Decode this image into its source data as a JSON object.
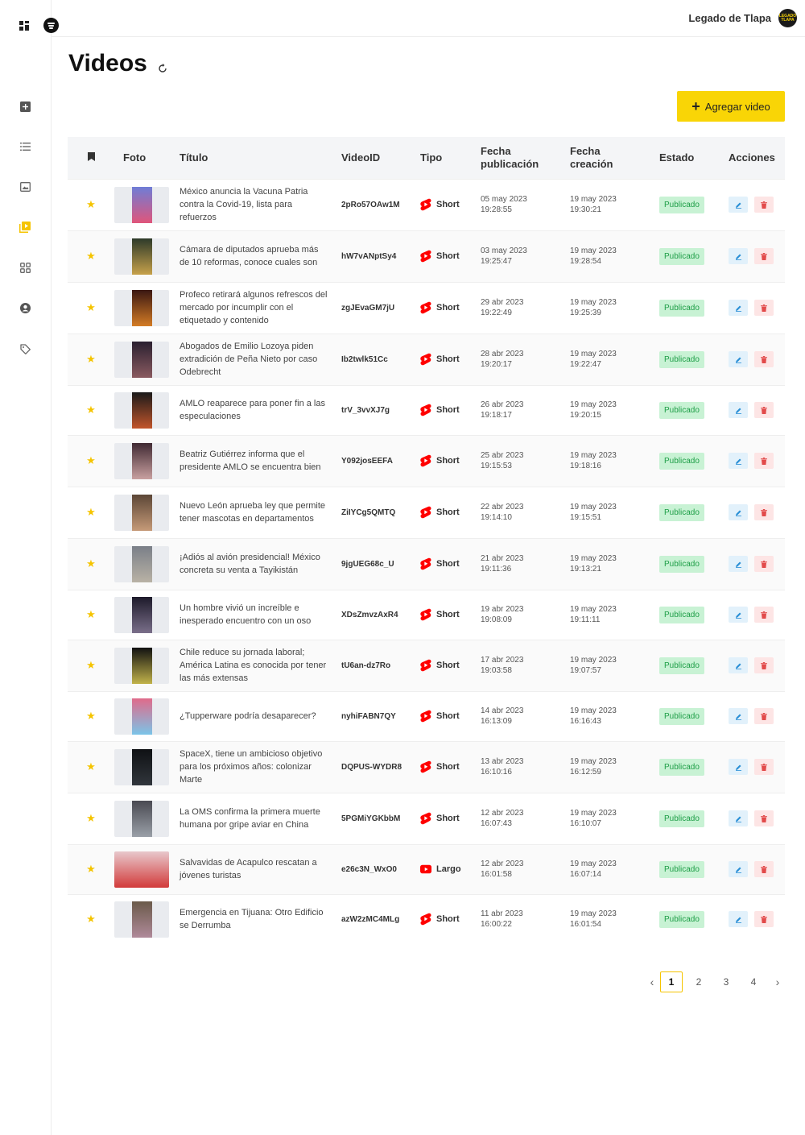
{
  "header": {
    "brand_name": "Legado de Tlapa",
    "brand_avatar_text": "LEGADO TLAPA"
  },
  "sidebar": {
    "items": [
      {
        "icon": "add-box-icon"
      },
      {
        "icon": "list-icon"
      },
      {
        "icon": "image-icon"
      },
      {
        "icon": "video-library-icon",
        "active": true
      },
      {
        "icon": "grid-icon"
      },
      {
        "icon": "account-icon"
      },
      {
        "icon": "tag-icon"
      }
    ]
  },
  "page": {
    "title": "Videos",
    "add_button_label": "Agregar video"
  },
  "table": {
    "columns": {
      "foto": "Foto",
      "titulo": "Título",
      "videoid": "VideoID",
      "tipo": "Tipo",
      "fecha_pub_1": "Fecha",
      "fecha_pub_2": "publicación",
      "fecha_cre_1": "Fecha",
      "fecha_cre_2": "creación",
      "estado": "Estado",
      "acciones": "Acciones"
    },
    "rows": [
      {
        "title": "México anuncia la Vacuna Patria contra la Covid-19, lista para refuerzos",
        "video_id": "2pRo57OAw1M",
        "tipo": "Short",
        "pub_date": "05 may 2023",
        "pub_time": "19:28:55",
        "cre_date": "19 may 2023",
        "cre_time": "19:30:21",
        "estado": "Publicado"
      },
      {
        "title": "Cámara de diputados aprueba más de 10 reformas, conoce cuales son",
        "video_id": "hW7vANptSy4",
        "tipo": "Short",
        "pub_date": "03 may 2023",
        "pub_time": "19:25:47",
        "cre_date": "19 may 2023",
        "cre_time": "19:28:54",
        "estado": "Publicado"
      },
      {
        "title": "Profeco retirará algunos refrescos del mercado por incumplir con el etiquetado y contenido",
        "video_id": "zgJEvaGM7jU",
        "tipo": "Short",
        "pub_date": "29 abr 2023",
        "pub_time": "19:22:49",
        "cre_date": "19 may 2023",
        "cre_time": "19:25:39",
        "estado": "Publicado"
      },
      {
        "title": "Abogados de Emilio Lozoya piden extradición de Peña Nieto por caso Odebrecht",
        "video_id": "Ib2twlk51Cc",
        "tipo": "Short",
        "pub_date": "28 abr 2023",
        "pub_time": "19:20:17",
        "cre_date": "19 may 2023",
        "cre_time": "19:22:47",
        "estado": "Publicado"
      },
      {
        "title": "AMLO reaparece para poner fin a las especulaciones",
        "video_id": "trV_3vvXJ7g",
        "tipo": "Short",
        "pub_date": "26 abr 2023",
        "pub_time": "19:18:17",
        "cre_date": "19 may 2023",
        "cre_time": "19:20:15",
        "estado": "Publicado"
      },
      {
        "title": "Beatriz Gutiérrez informa que el presidente AMLO se encuentra bien",
        "video_id": "Y092josEEFA",
        "tipo": "Short",
        "pub_date": "25 abr 2023",
        "pub_time": "19:15:53",
        "cre_date": "19 may 2023",
        "cre_time": "19:18:16",
        "estado": "Publicado"
      },
      {
        "title": "Nuevo León aprueba ley que permite tener mascotas en departamentos",
        "video_id": "ZiIYCg5QMTQ",
        "tipo": "Short",
        "pub_date": "22 abr 2023",
        "pub_time": "19:14:10",
        "cre_date": "19 may 2023",
        "cre_time": "19:15:51",
        "estado": "Publicado"
      },
      {
        "title": "¡Adiós al avión presidencial! México concreta su venta a Tayikistán",
        "video_id": "9jgUEG68c_U",
        "tipo": "Short",
        "pub_date": "21 abr 2023",
        "pub_time": "19:11:36",
        "cre_date": "19 may 2023",
        "cre_time": "19:13:21",
        "estado": "Publicado"
      },
      {
        "title": "Un hombre vivió un increíble e inesperado encuentro con un oso",
        "video_id": "XDsZmvzAxR4",
        "tipo": "Short",
        "pub_date": "19 abr 2023",
        "pub_time": "19:08:09",
        "cre_date": "19 may 2023",
        "cre_time": "19:11:11",
        "estado": "Publicado"
      },
      {
        "title": "Chile reduce su jornada laboral; América Latina es conocida por tener las más extensas",
        "video_id": "tU6an-dz7Ro",
        "tipo": "Short",
        "pub_date": "17 abr 2023",
        "pub_time": "19:03:58",
        "cre_date": "19 may 2023",
        "cre_time": "19:07:57",
        "estado": "Publicado"
      },
      {
        "title": "¿Tupperware podría desaparecer?",
        "video_id": "nyhiFABN7QY",
        "tipo": "Short",
        "pub_date": "14 abr 2023",
        "pub_time": "16:13:09",
        "cre_date": "19 may 2023",
        "cre_time": "16:16:43",
        "estado": "Publicado"
      },
      {
        "title": "SpaceX, tiene un ambicioso objetivo para los próximos años: colonizar Marte",
        "video_id": "DQPUS-WYDR8",
        "tipo": "Short",
        "pub_date": "13 abr 2023",
        "pub_time": "16:10:16",
        "cre_date": "19 may 2023",
        "cre_time": "16:12:59",
        "estado": "Publicado"
      },
      {
        "title": "La OMS confirma la primera muerte humana por gripe aviar en China",
        "video_id": "5PGMiYGKbbM",
        "tipo": "Short",
        "pub_date": "12 abr 2023",
        "pub_time": "16:07:43",
        "cre_date": "19 may 2023",
        "cre_time": "16:10:07",
        "estado": "Publicado"
      },
      {
        "title": "Salvavidas de Acapulco rescatan a jóvenes turistas",
        "video_id": "e26c3N_WxO0",
        "tipo": "Largo",
        "pub_date": "12 abr 2023",
        "pub_time": "16:01:58",
        "cre_date": "19 may 2023",
        "cre_time": "16:07:14",
        "estado": "Publicado"
      },
      {
        "title": "Emergencia en Tijuana: Otro Edificio se Derrumba",
        "video_id": "azW2zMC4MLg",
        "tipo": "Short",
        "pub_date": "11 abr 2023",
        "pub_time": "16:00:22",
        "cre_date": "19 may 2023",
        "cre_time": "16:01:54",
        "estado": "Publicado"
      }
    ]
  },
  "pagination": {
    "pages": [
      "1",
      "2",
      "3",
      "4"
    ],
    "current": "1",
    "prev": "‹",
    "next": "›"
  },
  "colors": {
    "accent": "#f9d506",
    "status_green": "#1e9e47",
    "status_bg": "#c8f2d4",
    "youtube_red": "#ff0000"
  }
}
